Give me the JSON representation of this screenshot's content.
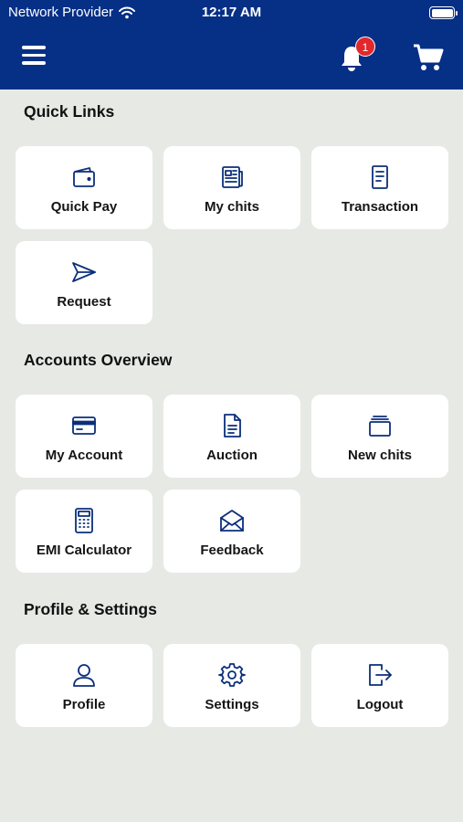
{
  "status_bar": {
    "carrier": "Network Provider",
    "time": "12:17 AM"
  },
  "header": {
    "notification_count": "1"
  },
  "sections": {
    "quick_links": {
      "title": "Quick Links",
      "items": [
        {
          "label": "Quick Pay",
          "icon": "wallet-icon"
        },
        {
          "label": "My chits",
          "icon": "newspaper-icon"
        },
        {
          "label": "Transaction",
          "icon": "document-icon"
        },
        {
          "label": "Request",
          "icon": "send-icon"
        }
      ]
    },
    "accounts_overview": {
      "title": "Accounts Overview",
      "items": [
        {
          "label": "My Account",
          "icon": "card-icon"
        },
        {
          "label": "Auction",
          "icon": "file-icon"
        },
        {
          "label": "New chits",
          "icon": "stack-icon"
        },
        {
          "label": "EMI Calculator",
          "icon": "calculator-icon"
        },
        {
          "label": "Feedback",
          "icon": "envelope-icon"
        }
      ]
    },
    "profile_settings": {
      "title": "Profile & Settings",
      "items": [
        {
          "label": "Profile",
          "icon": "user-icon"
        },
        {
          "label": "Settings",
          "icon": "gear-icon"
        },
        {
          "label": "Logout",
          "icon": "logout-icon"
        }
      ]
    }
  },
  "colors": {
    "header_bg": "#062f86",
    "page_bg": "#e7e9e5",
    "icon": "#0b2f7a",
    "badge": "#e0282d"
  }
}
